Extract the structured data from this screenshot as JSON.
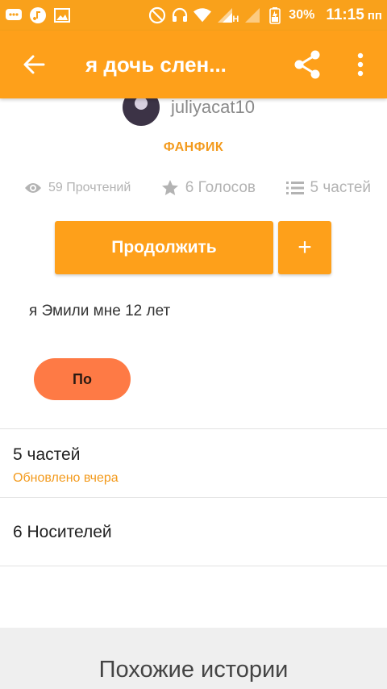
{
  "status_bar": {
    "battery": "30%",
    "time": "11:15",
    "ampm": "пп",
    "network_label": "H",
    "left_icons": [
      "chat-icon",
      "music-icon",
      "image-icon"
    ],
    "right_icons": [
      "no-disturb-icon",
      "headset-icon",
      "wifi-icon",
      "signal-icon",
      "signal-2-icon",
      "battery-icon"
    ]
  },
  "toolbar": {
    "title": "я дочь слен...",
    "back_icon": "arrow-left-icon",
    "share_icon": "share-icon",
    "menu_icon": "more-vert-icon"
  },
  "story": {
    "author": "juliyacat10",
    "category": "ФАНФИК",
    "stats": {
      "reads": "59 Прочтений",
      "votes": "6 Голосов",
      "parts": "5 частей"
    },
    "continue_label": "Продолжить",
    "add_label": "+",
    "description": "я Эмили мне 12 лет",
    "tag": "По"
  },
  "sections": {
    "parts_title": "5 частей",
    "parts_updated": "Обновлено вчера",
    "lists_title": "6 Носителей",
    "similar_title": "Похожие истории"
  },
  "colors": {
    "accent": "#fea01a",
    "tag": "#fe7a45",
    "orange_text": "#f39a1c"
  }
}
